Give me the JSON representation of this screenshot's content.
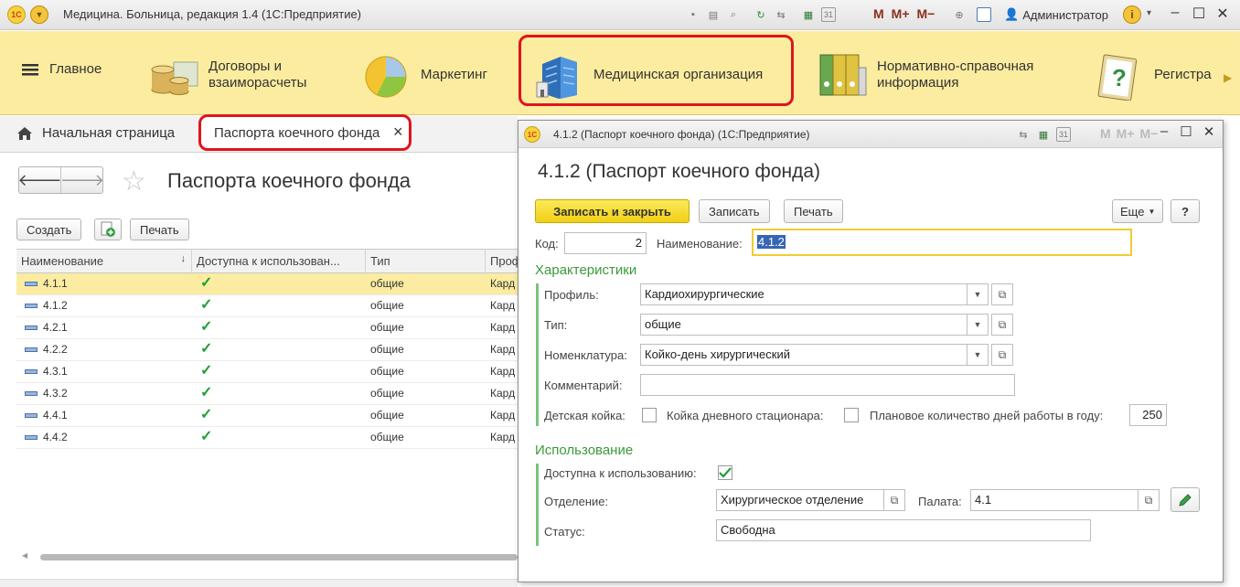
{
  "app": {
    "title": "Медицина. Больница, редакция 1.4 (1С:Предприятие)",
    "logo_text": "1C",
    "user": "Администратор",
    "mem_buttons": [
      "M",
      "M+",
      "M−"
    ]
  },
  "sections": [
    {
      "label": "Главное",
      "icon": "hamburger-icon"
    },
    {
      "label": "Договоры и взаиморасчеты",
      "icon": "coins-icon"
    },
    {
      "label": "Маркетинг",
      "icon": "pie-chart-icon"
    },
    {
      "label": "Медицинская организация",
      "icon": "hospital-building-icon"
    },
    {
      "label": "Нормативно-справочная информация",
      "icon": "binders-icon"
    },
    {
      "label": "Регистра",
      "icon": "clipboard-question-icon"
    }
  ],
  "tabs": {
    "home": "Начальная страница",
    "active": "Паспорта коечного фонда",
    "close": "×"
  },
  "list": {
    "title": "Паспорта коечного фонда",
    "create": "Создать",
    "print": "Печать",
    "columns": [
      "Наименование",
      "Доступна к использован...",
      "Тип",
      "Проф"
    ],
    "rows": [
      {
        "name": "4.1.1",
        "type": "общие",
        "profile": "Кард",
        "selected": true
      },
      {
        "name": "4.1.2",
        "type": "общие",
        "profile": "Кард",
        "selected": false
      },
      {
        "name": "4.2.1",
        "type": "общие",
        "profile": "Кард",
        "selected": false
      },
      {
        "name": "4.2.2",
        "type": "общие",
        "profile": "Кард",
        "selected": false
      },
      {
        "name": "4.3.1",
        "type": "общие",
        "profile": "Кард",
        "selected": false
      },
      {
        "name": "4.3.2",
        "type": "общие",
        "profile": "Кард",
        "selected": false
      },
      {
        "name": "4.4.1",
        "type": "общие",
        "profile": "Кард",
        "selected": false
      },
      {
        "name": "4.4.2",
        "type": "общие",
        "profile": "Кард",
        "selected": false
      }
    ]
  },
  "modal": {
    "window_title": "4.1.2 (Паспорт коечного фонда)  (1С:Предприятие)",
    "heading": "4.1.2 (Паспорт коечного фонда)",
    "save_close": "Записать и закрыть",
    "save": "Записать",
    "print": "Печать",
    "more": "Еще",
    "help": "?",
    "code_label": "Код:",
    "code_value": "2",
    "name_label": "Наименование:",
    "name_value": "4.1.2",
    "group1": "Характеристики",
    "profile_label": "Профиль:",
    "profile_value": "Кардиохирургические",
    "type_label": "Тип:",
    "type_value": "общие",
    "nomenclature_label": "Номенклатура:",
    "nomenclature_value": "Койко-день хирургический",
    "comment_label": "Комментарий:",
    "comment_value": "",
    "child_bed_label": "Детская койка:",
    "day_bed_label": "Койка дневного стационара:",
    "plan_days_label": "Плановое количество дней работы в году:",
    "plan_days_value": "250",
    "group2": "Использование",
    "available_label": "Доступна к использованию:",
    "department_label": "Отделение:",
    "department_value": "Хирургическое отделение",
    "ward_label": "Палата:",
    "ward_value": "4.1",
    "status_label": "Статус:",
    "status_value": "Свободна"
  }
}
